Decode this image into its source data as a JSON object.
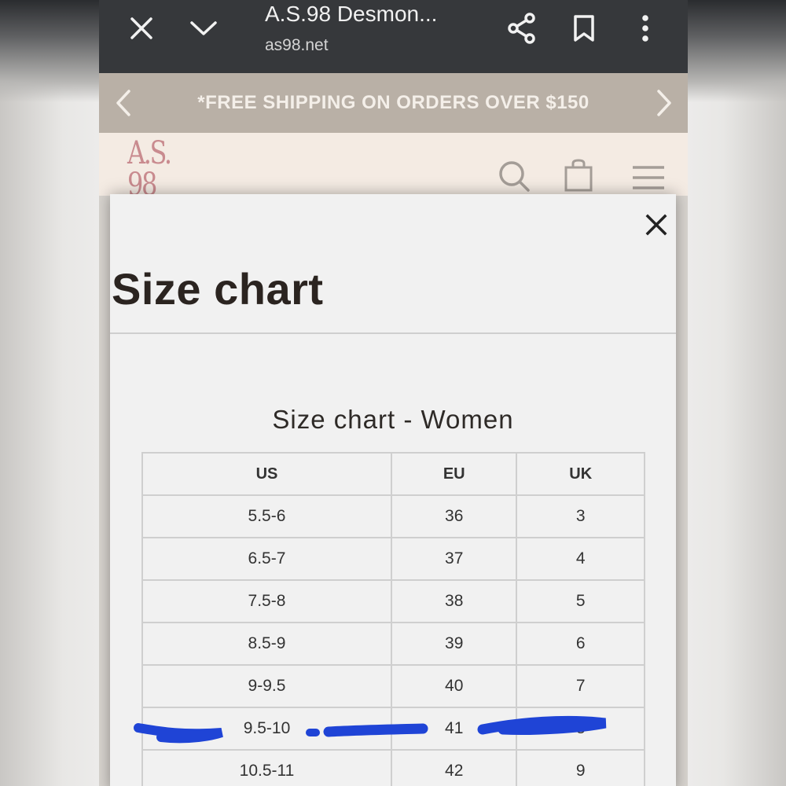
{
  "browser": {
    "title": "A.S.98 Desmon...",
    "url": "as98.net",
    "icons": [
      "close-icon",
      "chevron-down-icon",
      "share-icon",
      "bookmark-icon",
      "more-vert-icon"
    ]
  },
  "announcement": {
    "text": "*FREE SHIPPING ON ORDERS OVER $150"
  },
  "site_header": {
    "logo_line1": "A.S.",
    "logo_line2": "98",
    "icons": [
      "search-icon",
      "shopping-bag-icon",
      "menu-icon"
    ]
  },
  "modal": {
    "title": "Size chart",
    "subtitle": "Size chart - Women",
    "table": {
      "headers": [
        "US",
        "EU",
        "UK"
      ],
      "rows": [
        [
          "5.5-6",
          "36",
          "3"
        ],
        [
          "6.5-7",
          "37",
          "4"
        ],
        [
          "7.5-8",
          "38",
          "5"
        ],
        [
          "8.5-9",
          "39",
          "6"
        ],
        [
          "9-9.5",
          "40",
          "7"
        ],
        [
          "9.5-10",
          "41",
          "8"
        ],
        [
          "10.5-11",
          "42",
          "9"
        ]
      ]
    },
    "highlight_color": "#1f44d6"
  },
  "colors": {
    "chrome_bg": "#36383b",
    "announce_bg": "#b9b0a6",
    "header_bg": "#f4ebe3",
    "logo": "#c98b8f"
  }
}
